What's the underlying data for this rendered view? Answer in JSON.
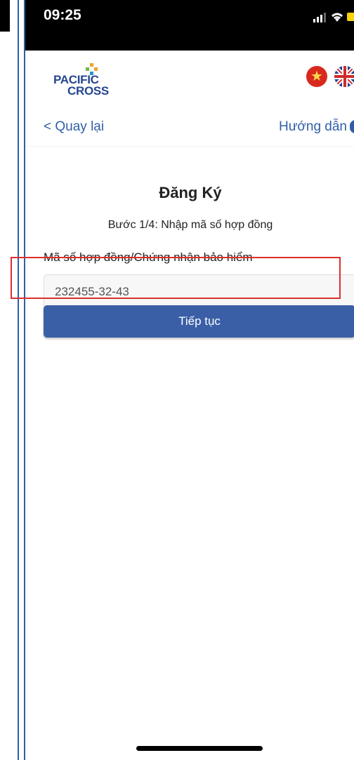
{
  "status_bar": {
    "time": "09:25"
  },
  "header": {
    "logo_line1": "PACIFIC",
    "logo_line2": "CROSS",
    "flags": [
      "vietnam-flag-icon",
      "uk-flag-icon"
    ]
  },
  "nav": {
    "back_label": "< Quay lại",
    "help_label": "Hướng dẫn"
  },
  "form": {
    "title": "Đăng Ký",
    "step": "Bước 1/4: Nhập mã số hợp đồng",
    "field_label": "Mã số hợp đồng/Chứng nhận bảo hiểm",
    "field_value": "232455-32-43",
    "submit_label": "Tiếp tục"
  },
  "colors": {
    "brand_blue": "#25468f",
    "button_blue": "#3a5fa6",
    "link_blue": "#2f5ea8",
    "highlight_red": "#d9302b"
  }
}
